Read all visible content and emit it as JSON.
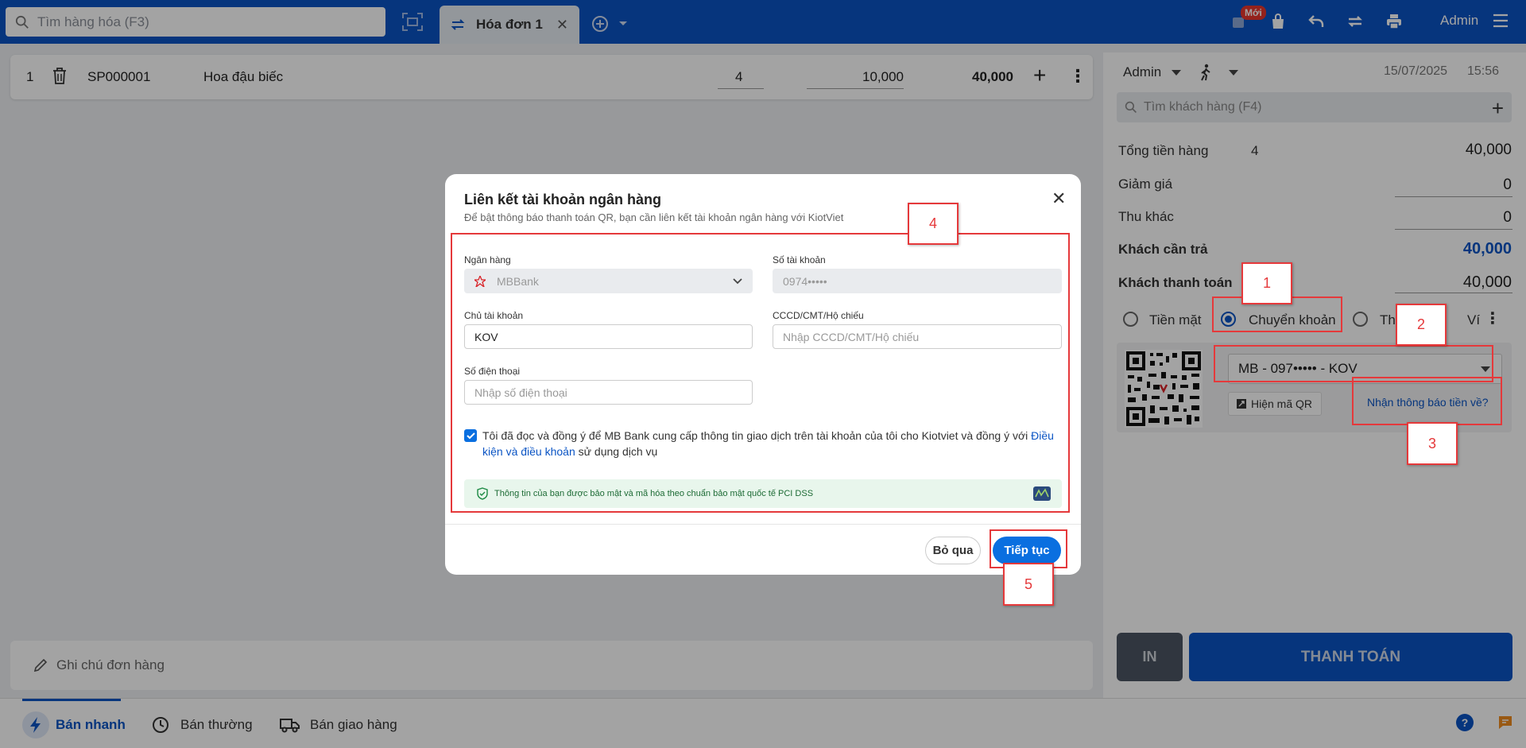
{
  "topbar": {
    "search_placeholder": "Tìm hàng hóa (F3)",
    "tab_label": "Hóa đơn 1",
    "new_badge": "Mới",
    "user": "Admin"
  },
  "cart": {
    "index": "1",
    "code": "SP000001",
    "name": "Hoa đậu biếc",
    "qty": "4",
    "price": "10,000",
    "total": "40,000"
  },
  "note_placeholder": "Ghi chú đơn hàng",
  "bottom_nav": [
    {
      "label": "Bán nhanh"
    },
    {
      "label": "Bán thường"
    },
    {
      "label": "Bán giao hàng"
    }
  ],
  "panel": {
    "seller": "Admin",
    "date": "15/07/2025",
    "time": "15:56",
    "customer_search": "Tìm khách hàng (F4)",
    "total_label": "Tổng tiền hàng",
    "total_count": "4",
    "total_value": "40,000",
    "discount_label": "Giảm giá",
    "discount_value": "0",
    "other_label": "Thu khác",
    "other_value": "0",
    "need_pay_label": "Khách cần trả",
    "need_pay_value": "40,000",
    "paid_label": "Khách thanh toán",
    "paid_value": "40,000",
    "method_cash": "Tiền mặt",
    "method_transfer": "Chuyển khoản",
    "method_card": "Th",
    "method_wallet": "Ví",
    "bank_account": "MB - 097••••• - KOV",
    "show_qr": "Hiện mã QR",
    "notify_link": "Nhận thông báo tiền về?",
    "btn_print": "IN",
    "btn_pay": "THANH TOÁN"
  },
  "modal": {
    "title": "Liên kết tài khoản ngân hàng",
    "subtitle": "Để bật thông báo thanh toán QR, bạn cần liên kết tài khoản ngân hàng với KiotViet",
    "bank_label": "Ngân hàng",
    "bank_value": "MBBank",
    "account_label": "Số tài khoản",
    "account_value": "0974•••••",
    "owner_label": "Chủ tài khoản",
    "owner_value": "KOV",
    "id_label": "CCCD/CMT/Hộ chiếu",
    "id_placeholder": "Nhập CCCD/CMT/Hộ chiếu",
    "phone_label": "Số điện thoại",
    "phone_placeholder": "Nhập số điện thoại",
    "agree_text": "Tôi đã đọc và đồng ý để MB Bank cung cấp thông tin giao dịch trên tài khoản của tôi cho Kiotviet và đồng ý với ",
    "agree_link": "Điều kiện và điều khoản",
    "agree_tail": " sử dụng dịch vụ",
    "secure_text": "Thông tin của bạn được bảo mật và mã hóa theo chuẩn bảo mật quốc tế PCI DSS",
    "btn_skip": "Bỏ qua",
    "btn_next": "Tiếp tục"
  },
  "callouts": [
    "1",
    "2",
    "3",
    "4",
    "5"
  ],
  "colors": {
    "brand": "#0a54c4",
    "accent_red": "#e5393b",
    "primary_button": "#0a6fe0"
  }
}
